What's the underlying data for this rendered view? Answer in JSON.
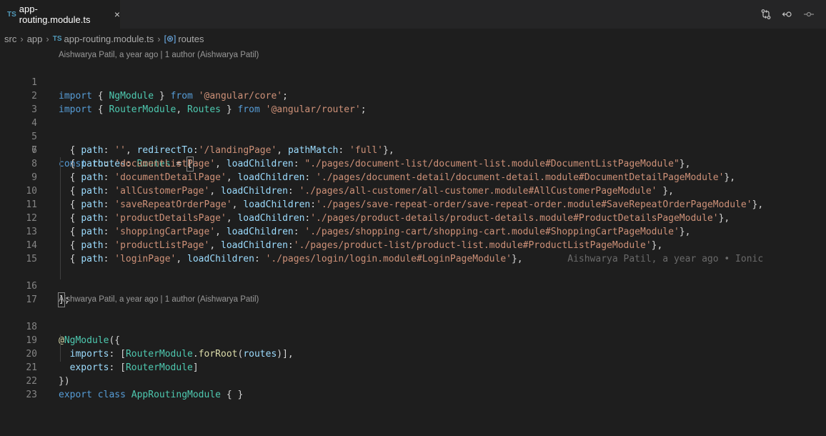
{
  "tab": {
    "badge": "TS",
    "title": "app-routing.module.ts",
    "close_label": "×"
  },
  "breadcrumb": {
    "items": [
      "src",
      "app",
      "app-routing.module.ts",
      "routes"
    ],
    "file_badge": "TS",
    "symbol_icon": "[⊛]",
    "separator": "›"
  },
  "codelens": {
    "first": "Aishwarya Patil, a year ago | 1 author (Aishwarya Patil)",
    "second": "Aishwarya Patil, a year ago | 1 author (Aishwarya Patil)"
  },
  "inline_blame": "Aishwarya Patil, a year ago • Ionic",
  "line_numbers": [
    "1",
    "2",
    "3",
    "4",
    "5",
    "6",
    "7",
    "8",
    "9",
    "10",
    "11",
    "12",
    "13",
    "14",
    "15",
    "16",
    "17",
    "18",
    "19",
    "20",
    "21",
    "22",
    "23"
  ],
  "code": {
    "l1": [
      "import",
      " { ",
      "NgModule",
      " } ",
      "from",
      " ",
      "'@angular/core'",
      ";"
    ],
    "l2": [
      "import",
      " { ",
      "RouterModule",
      ", ",
      "Routes",
      " } ",
      "from",
      " ",
      "'@angular/router'",
      ";"
    ],
    "l6": [
      "const",
      " ",
      "routes",
      ": ",
      "Routes",
      " = ",
      "[",
      ""
    ],
    "routes": [
      {
        "path": "''",
        "key": "redirectTo",
        "sep": ":",
        "value": "'/landingPage'",
        "extra_key": "pathMatch",
        "extra_value": "'full'",
        "end": "},"
      },
      {
        "path": "'documentListPage'",
        "key": "loadChildren",
        "sep": ": ",
        "value": "\"./pages/document-list/document-list.module#DocumentListPageModule\"",
        "end": "},"
      },
      {
        "path": "'documentDetailPage'",
        "key": "loadChildren",
        "sep": ": ",
        "value": "'./pages/document-detail/document-detail.module#DocumentDetailPageModule'",
        "end": "},"
      },
      {
        "path": "'allCustomerPage'",
        "key": "loadChildren",
        "sep": ": ",
        "value": "'./pages/all-customer/all-customer.module#AllCustomerPageModule'",
        "end": " },"
      },
      {
        "path": "'saveRepeatOrderPage'",
        "key": "loadChildren",
        "sep": ":",
        "value": "'./pages/save-repeat-order/save-repeat-order.module#SaveRepeatOrderPageModule'",
        "end": "},"
      },
      {
        "path": "'productDetailsPage'",
        "key": "loadChildren",
        "sep": ":",
        "value": "'./pages/product-details/product-details.module#ProductDetailsPageModule'",
        "end": "},"
      },
      {
        "path": "'shoppingCartPage'",
        "key": "loadChildren",
        "sep": ": ",
        "value": "'./pages/shopping-cart/shopping-cart.module#ShoppingCartPageModule'",
        "end": "},"
      },
      {
        "path": "'productListPage'",
        "key": "loadChildren",
        "sep": ":",
        "value": "'./pages/product-list/product-list.module#ProductListPageModule'",
        "end": "},"
      },
      {
        "path": "'loginPage'",
        "key": "loadChildren",
        "sep": ": ",
        "value": "'./pages/login/login.module#LoginPageModule'",
        "end": "},"
      }
    ],
    "l16": [
      "]",
      ";"
    ],
    "l18": [
      "@",
      "NgModule",
      "({"
    ],
    "l19": [
      "imports",
      ": [",
      "RouterModule",
      ".",
      "forRoot",
      "(",
      "routes",
      ")],"
    ],
    "l20": [
      "exports",
      ": [",
      "RouterModule",
      "]"
    ],
    "l21": [
      "})"
    ],
    "l22": [
      "export",
      " ",
      "class",
      " ",
      "AppRoutingModule",
      " { }"
    ]
  },
  "colors": {
    "background": "#1e1e1e",
    "keyword": "#569cd6",
    "string": "#ce9178",
    "type": "#4ec9b0",
    "variable": "#9cdcfe",
    "function": "#dcdcaa"
  },
  "icons": [
    "ts-file-icon",
    "close-icon",
    "git-compare-icon",
    "go-back-icon",
    "git-commit-icon",
    "variable-symbol-icon"
  ]
}
